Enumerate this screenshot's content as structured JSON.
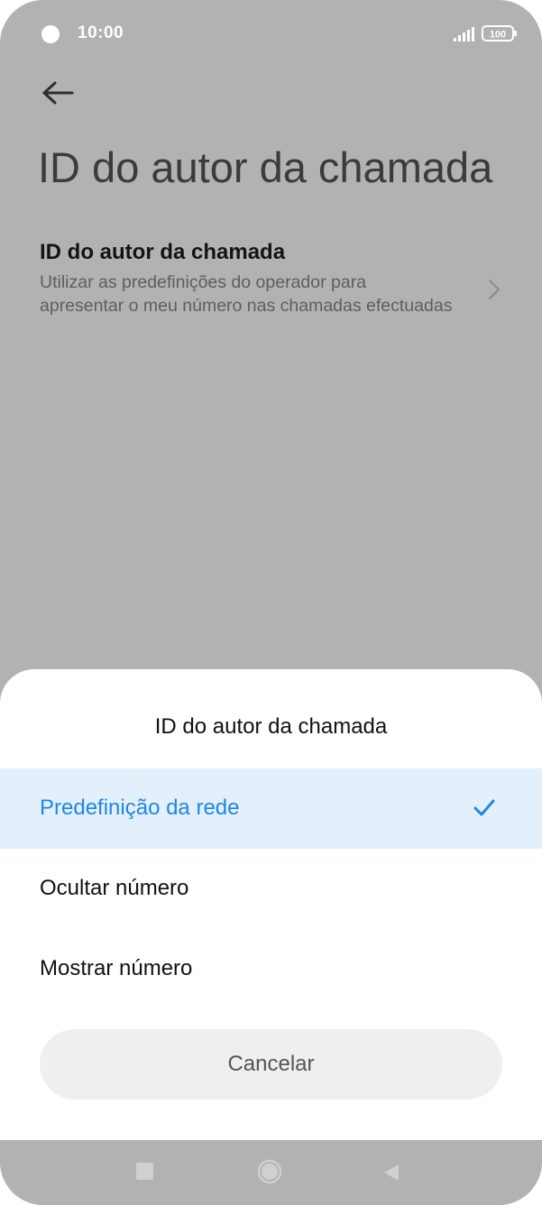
{
  "status_bar": {
    "time": "10:00",
    "battery": "100"
  },
  "header": {
    "title": "ID do autor da chamada"
  },
  "setting": {
    "title": "ID do autor da chamada",
    "description": "Utilizar as predefinições do operador para apresentar o meu número nas chamadas efectuadas"
  },
  "dialog": {
    "title": "ID do autor da chamada",
    "options": [
      {
        "label": "Predefinição da rede",
        "selected": true
      },
      {
        "label": "Ocultar número",
        "selected": false
      },
      {
        "label": "Mostrar número",
        "selected": false
      }
    ],
    "cancel_label": "Cancelar"
  },
  "colors": {
    "accent": "#1f87e5",
    "selected_background": "#e3effb",
    "dim_overlay": "#b2b2b2"
  },
  "icons": {
    "back": "arrow-left-icon",
    "chevron": "chevron-right-icon",
    "check": "check-icon",
    "nav": [
      "recents-icon",
      "home-icon",
      "back-triangle-icon"
    ]
  }
}
